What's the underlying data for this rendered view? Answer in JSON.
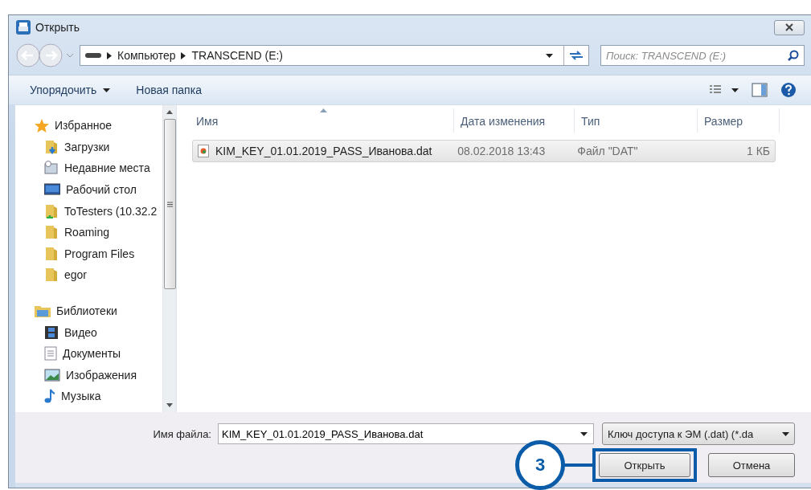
{
  "window": {
    "title": "Открыть"
  },
  "address": {
    "path": [
      "Компьютер",
      "TRANSCEND (E:)"
    ]
  },
  "search": {
    "placeholder": "Поиск: TRANSCEND (E:)"
  },
  "toolbar": [
    {
      "label": "Упорядочить",
      "kind": "menu"
    },
    {
      "label": "Новая папка",
      "kind": "plain"
    }
  ],
  "sidebar": {
    "groups": [
      {
        "label": "Избранное",
        "kind": "star",
        "children": [
          {
            "label": "Загрузки",
            "kind": "download"
          },
          {
            "label": "Недавние места",
            "kind": "recent"
          },
          {
            "label": "Рабочий стол",
            "kind": "desktop"
          },
          {
            "label": "ToTesters (10.32.2",
            "kind": "network"
          },
          {
            "label": "Roaming",
            "kind": "folder"
          },
          {
            "label": "Program Files",
            "kind": "folder"
          },
          {
            "label": "egor",
            "kind": "folder"
          }
        ]
      },
      {
        "label": "Библиотеки",
        "kind": "library",
        "children": [
          {
            "label": "Видео",
            "kind": "video"
          },
          {
            "label": "Документы",
            "kind": "document"
          },
          {
            "label": "Изображения",
            "kind": "image"
          },
          {
            "label": "Музыка",
            "kind": "music"
          }
        ]
      }
    ]
  },
  "table": {
    "columns": [
      {
        "label": "Имя",
        "sorted": true
      },
      {
        "label": "Дата изменения",
        "sorted": false
      },
      {
        "label": "Тип",
        "sorted": false
      },
      {
        "label": "Размер",
        "sorted": false
      }
    ],
    "rows": [
      {
        "cells": [
          "KIM_KEY_01.01.2019_PASS_Иванова.dat",
          "08.02.2018 13:43",
          "Файл \"DAT\"",
          "1 КБ"
        ],
        "selected": true
      }
    ]
  },
  "footer": {
    "filename_label": "Имя файла:",
    "filename": "KIM_KEY_01.01.2019_PASS_Иванова.dat",
    "filetype": "Ключ доступа к ЭМ (.dat) (*.da",
    "buttons": [
      {
        "label": "Открыть",
        "annotated": true
      },
      {
        "label": "Отмена",
        "annotated": false
      }
    ]
  },
  "annotation": {
    "label": "3"
  }
}
